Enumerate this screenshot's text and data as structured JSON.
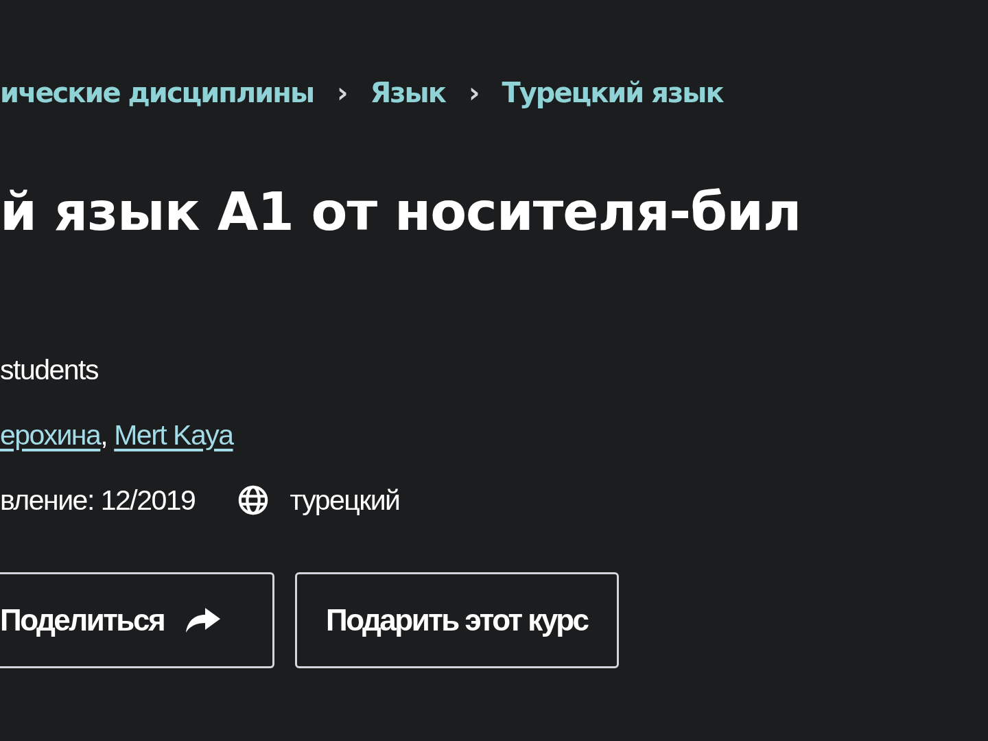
{
  "breadcrumbs": [
    {
      "label": "ические дисциплины"
    },
    {
      "label": "Язык"
    },
    {
      "label": "Турецкий язык"
    }
  ],
  "breadcrumb_separator": "›",
  "title": "й язык А1 от носителя-бил",
  "students": "students",
  "authors": [
    {
      "name": "ерохина"
    },
    {
      "name": "Mert Kaya"
    }
  ],
  "author_separator": ",",
  "updated": "вление: 12/2019",
  "language": "турецкий",
  "buttons": [
    {
      "kind": "share",
      "label": "Поделиться"
    },
    {
      "kind": "plain",
      "label": "Подарить этот курс"
    }
  ]
}
